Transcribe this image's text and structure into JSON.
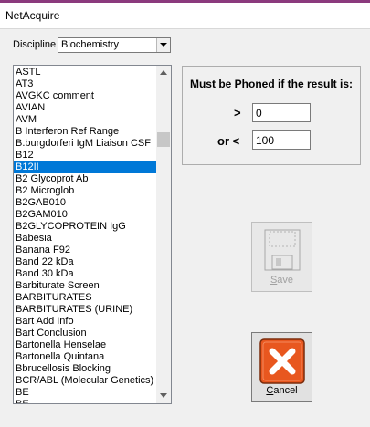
{
  "window": {
    "title": "NetAcquire"
  },
  "discipline": {
    "label": "Discipline",
    "selected": "Biochemistry"
  },
  "list": {
    "items": [
      "ASTL",
      "AT3",
      "AVGKC comment",
      "AVIAN",
      "AVM",
      "B Interferon Ref Range",
      "B.burgdorferi IgM Liaison CSF",
      "B12",
      "B12II",
      "B2 Glycoprot Ab",
      "B2 Microglob",
      "B2GAB010",
      "B2GAM010",
      "B2GLYCOPROTEIN IgG",
      "Babesia",
      "Banana F92",
      "Band 22 kDa",
      "Band 30 kDa",
      "Barbiturate Screen",
      "BARBITURATES",
      "BARBITURATES (URINE)",
      "Bart Add Info",
      "Bart Conclusion",
      "Bartonella Henselae",
      "Bartonella Quintana",
      "Bbrucellosis Blocking",
      "BCR/ABL (Molecular Genetics)",
      "BE",
      "BE..."
    ],
    "selected_index": 8
  },
  "phone": {
    "title": "Must be Phoned if the result is:",
    "gt_label": ">",
    "gt_value": "0",
    "lt_label": "or <",
    "lt_value": "100"
  },
  "buttons": {
    "save": {
      "label_mnemonic": "S",
      "label_rest": "ave",
      "enabled": false,
      "icon": "floppy-disk-icon"
    },
    "cancel": {
      "label_mnemonic": "C",
      "label_rest": "ancel",
      "enabled": true,
      "icon": "close-x-icon"
    }
  },
  "colors": {
    "selection": "#0078d7",
    "cancel_icon": "#e8571f",
    "top_accent": "#8b3a7d"
  }
}
